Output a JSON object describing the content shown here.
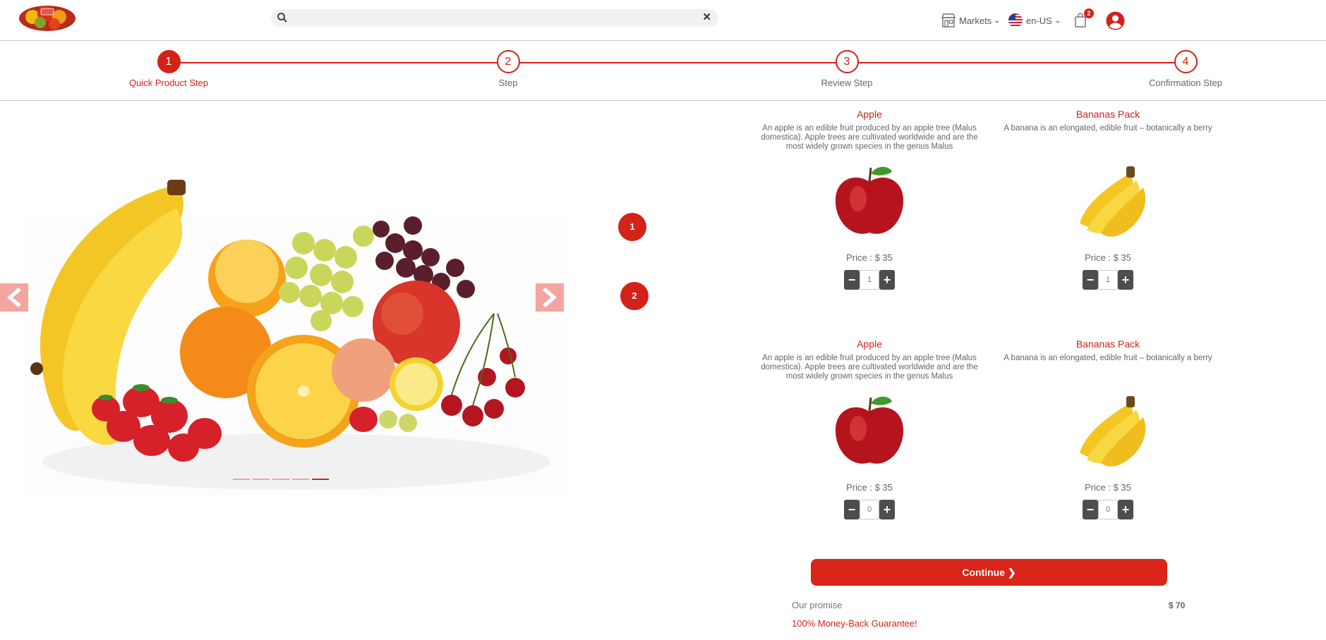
{
  "header": {
    "search": {
      "value": "",
      "placeholder": ""
    },
    "markets_label": "Markets",
    "language_label": "en-US",
    "cart_count": "2"
  },
  "stepper": {
    "steps": [
      {
        "number": "1",
        "label": "Quick Product Step",
        "active": true
      },
      {
        "number": "2",
        "label": "Step",
        "active": false
      },
      {
        "number": "3",
        "label": "Review Step",
        "active": false
      },
      {
        "number": "4",
        "label": "Confirmation Step",
        "active": false
      }
    ]
  },
  "carousel": {
    "slide_count": 5,
    "active_index": 4
  },
  "side_numbers": [
    "1",
    "2"
  ],
  "products": [
    {
      "title": "Apple",
      "description": "An apple is an edible fruit produced by an apple tree (Malus domestica). Apple trees are cultivated worldwide and are the most widely grown species in the genus Malus",
      "price": "Price : $ 35",
      "qty": "1",
      "image": "apple"
    },
    {
      "title": "Bananas Pack",
      "description": "A banana is an elongated, edible fruit – botanically a berry",
      "price": "Price : $ 35",
      "qty": "1",
      "image": "banana"
    },
    {
      "title": "Apple",
      "description": "An apple is an edible fruit produced by an apple tree (Malus domestica). Apple trees are cultivated worldwide and are the most widely grown species in the genus Malus",
      "price": "Price : $ 35",
      "qty": "0",
      "image": "apple"
    },
    {
      "title": "Bananas Pack",
      "description": "A banana is an elongated, edible fruit – botanically a berry",
      "price": "Price : $ 35",
      "qty": "0",
      "image": "banana"
    }
  ],
  "qty_controls": {
    "minus": "−",
    "plus": "+"
  },
  "continue_label": "Continue ❯",
  "summary": {
    "promise_label": "Our promise",
    "total": "$ 70",
    "guarantee": "100% Money-Back Guarantee!"
  },
  "colors": {
    "accent": "#d32218",
    "button": "#d9251a",
    "stepper_control": "#4d4d4d"
  }
}
